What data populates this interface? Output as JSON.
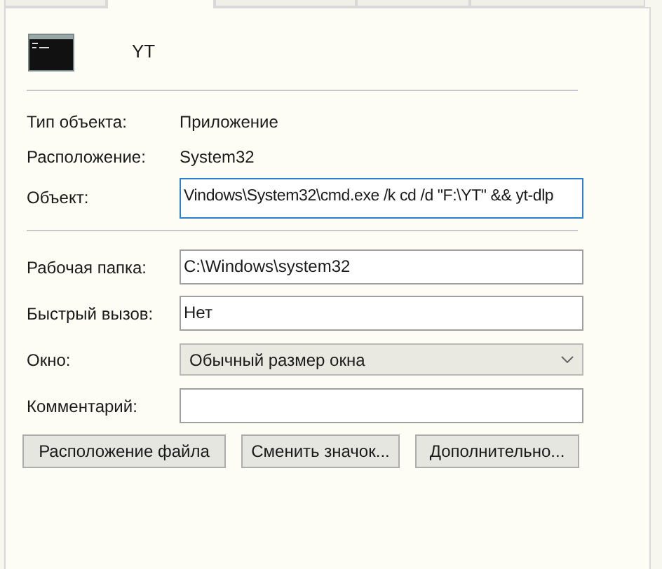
{
  "tabs": [
    {
      "selected": false
    },
    {
      "selected": true
    },
    {
      "selected": false
    },
    {
      "selected": false
    },
    {
      "selected": false
    }
  ],
  "shortcut": {
    "name": "YT"
  },
  "info": [
    {
      "label": "Тип объекта:",
      "value": "Приложение"
    },
    {
      "label": "Расположение:",
      "value": "System32"
    }
  ],
  "target": {
    "label": "Объект:",
    "value": "Vindows\\System32\\cmd.exe /k cd /d \"F:\\YT\" && yt-dlp",
    "focused": true
  },
  "fields": [
    {
      "kind": "text",
      "label": "Рабочая папка:",
      "value": "C:\\Windows\\system32"
    },
    {
      "kind": "text",
      "label": "Быстрый вызов:",
      "value": "Нет"
    },
    {
      "kind": "dropdown",
      "label": "Окно:",
      "value": "Обычный размер окна"
    },
    {
      "kind": "text",
      "label": "Комментарий:"
    }
  ],
  "buttons": [
    {
      "label": "Расположение файла"
    },
    {
      "label": "Сменить значок..."
    },
    {
      "label": "Дополнительно..."
    }
  ]
}
